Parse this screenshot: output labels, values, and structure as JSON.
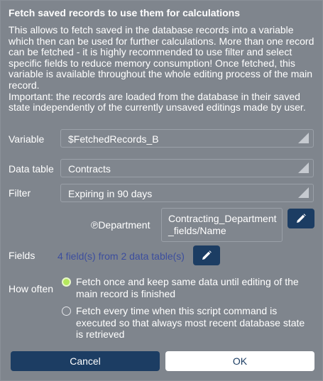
{
  "dialog": {
    "title": "Fetch saved records to use them for calculations",
    "description": "This allows to fetch saved in the database records into a variable which then can be used for further calculations. More than one record can be fetched - it is highly recommended to use filter and select specific fields to reduce memory consumption! Once fetched, this variable is available throughout the whole editing process of the main record.\nImportant: the records are loaded from the database in their saved state independently of the currently unsaved editings made by user."
  },
  "variable": {
    "label": "Variable",
    "value": "$FetchedRecords_B"
  },
  "data_table": {
    "label": "Data table",
    "value": "Contracts"
  },
  "filter": {
    "label": "Filter",
    "value": "Expiring in 90 days"
  },
  "department": {
    "label": "℗Department",
    "value": "Contracting_Department_fields/Name",
    "edit_icon": "pencil-icon"
  },
  "fields": {
    "label": "Fields",
    "value": "4 field(s) from 2 data table(s)",
    "edit_icon": "pencil-icon"
  },
  "how_often": {
    "label": "How often",
    "options": [
      {
        "label": "Fetch once and keep same data until editing of the main record is finished",
        "selected": true
      },
      {
        "label": "Fetch every time when this script command is executed so that always most recent database state is retrieved",
        "selected": false
      }
    ]
  },
  "buttons": {
    "cancel": "Cancel",
    "ok": "OK"
  },
  "colors": {
    "dialog_bg": "#7f858d",
    "primary_button": "#1c3d63",
    "link": "#3c4e9e",
    "radio_selected": "#b4e85c"
  }
}
